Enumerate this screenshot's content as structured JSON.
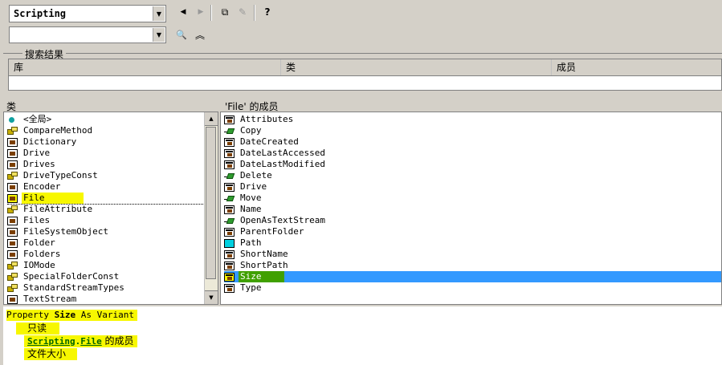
{
  "toolbar": {
    "library_combo": {
      "value": "Scripting"
    },
    "search_combo": {
      "value": ""
    },
    "buttons": {
      "back": "◀",
      "forward": "▶",
      "copy": "⧉",
      "view_definition": "✎",
      "help": "?",
      "search": "🔍",
      "toggle": "︽"
    }
  },
  "search_results": {
    "title": "搜索结果",
    "columns": [
      "库",
      "类",
      "成员"
    ]
  },
  "classes": {
    "header": "类",
    "items": [
      {
        "label": "<全局>",
        "icon": "global-icon"
      },
      {
        "label": "CompareMethod",
        "icon": "enum-icon"
      },
      {
        "label": "Dictionary",
        "icon": "class-icon"
      },
      {
        "label": "Drive",
        "icon": "class-icon"
      },
      {
        "label": "Drives",
        "icon": "class-icon"
      },
      {
        "label": "DriveTypeConst",
        "icon": "enum-icon"
      },
      {
        "label": "Encoder",
        "icon": "class-icon"
      },
      {
        "label": "File",
        "icon": "class-icon",
        "selected": true
      },
      {
        "label": "FileAttribute",
        "icon": "enum-icon"
      },
      {
        "label": "Files",
        "icon": "class-icon"
      },
      {
        "label": "FileSystemObject",
        "icon": "class-icon"
      },
      {
        "label": "Folder",
        "icon": "class-icon"
      },
      {
        "label": "Folders",
        "icon": "class-icon"
      },
      {
        "label": "IOMode",
        "icon": "enum-icon"
      },
      {
        "label": "SpecialFolderConst",
        "icon": "enum-icon"
      },
      {
        "label": "StandardStreamTypes",
        "icon": "enum-icon"
      },
      {
        "label": "TextStream",
        "icon": "class-icon"
      }
    ]
  },
  "members": {
    "header": "'File' 的成员",
    "items": [
      {
        "label": "Attributes",
        "icon": "property-icon"
      },
      {
        "label": "Copy",
        "icon": "method-icon"
      },
      {
        "label": "DateCreated",
        "icon": "property-icon"
      },
      {
        "label": "DateLastAccessed",
        "icon": "property-icon"
      },
      {
        "label": "DateLastModified",
        "icon": "property-icon"
      },
      {
        "label": "Delete",
        "icon": "method-icon"
      },
      {
        "label": "Drive",
        "icon": "property-icon"
      },
      {
        "label": "Move",
        "icon": "method-icon"
      },
      {
        "label": "Name",
        "icon": "property-icon"
      },
      {
        "label": "OpenAsTextStream",
        "icon": "method-icon"
      },
      {
        "label": "ParentFolder",
        "icon": "property-icon"
      },
      {
        "label": "Path",
        "icon": "path-icon"
      },
      {
        "label": "ShortName",
        "icon": "property-icon"
      },
      {
        "label": "ShortPath",
        "icon": "property-icon"
      },
      {
        "label": "Size",
        "icon": "property-icon",
        "selected": true
      },
      {
        "label": "Type",
        "icon": "property-icon"
      }
    ]
  },
  "details": {
    "declaration_prefix": "Property ",
    "declaration_name": "Size",
    "declaration_suffix": " As Variant",
    "readonly": "只读",
    "member_of_lib": "Scripting",
    "member_of_dot": ".",
    "member_of_class": "File",
    "member_of_suffix": " 的成员",
    "description": "文件大小"
  },
  "colors": {
    "highlight": "#f7f700",
    "selection": "#3399ff",
    "link": "#006400"
  }
}
